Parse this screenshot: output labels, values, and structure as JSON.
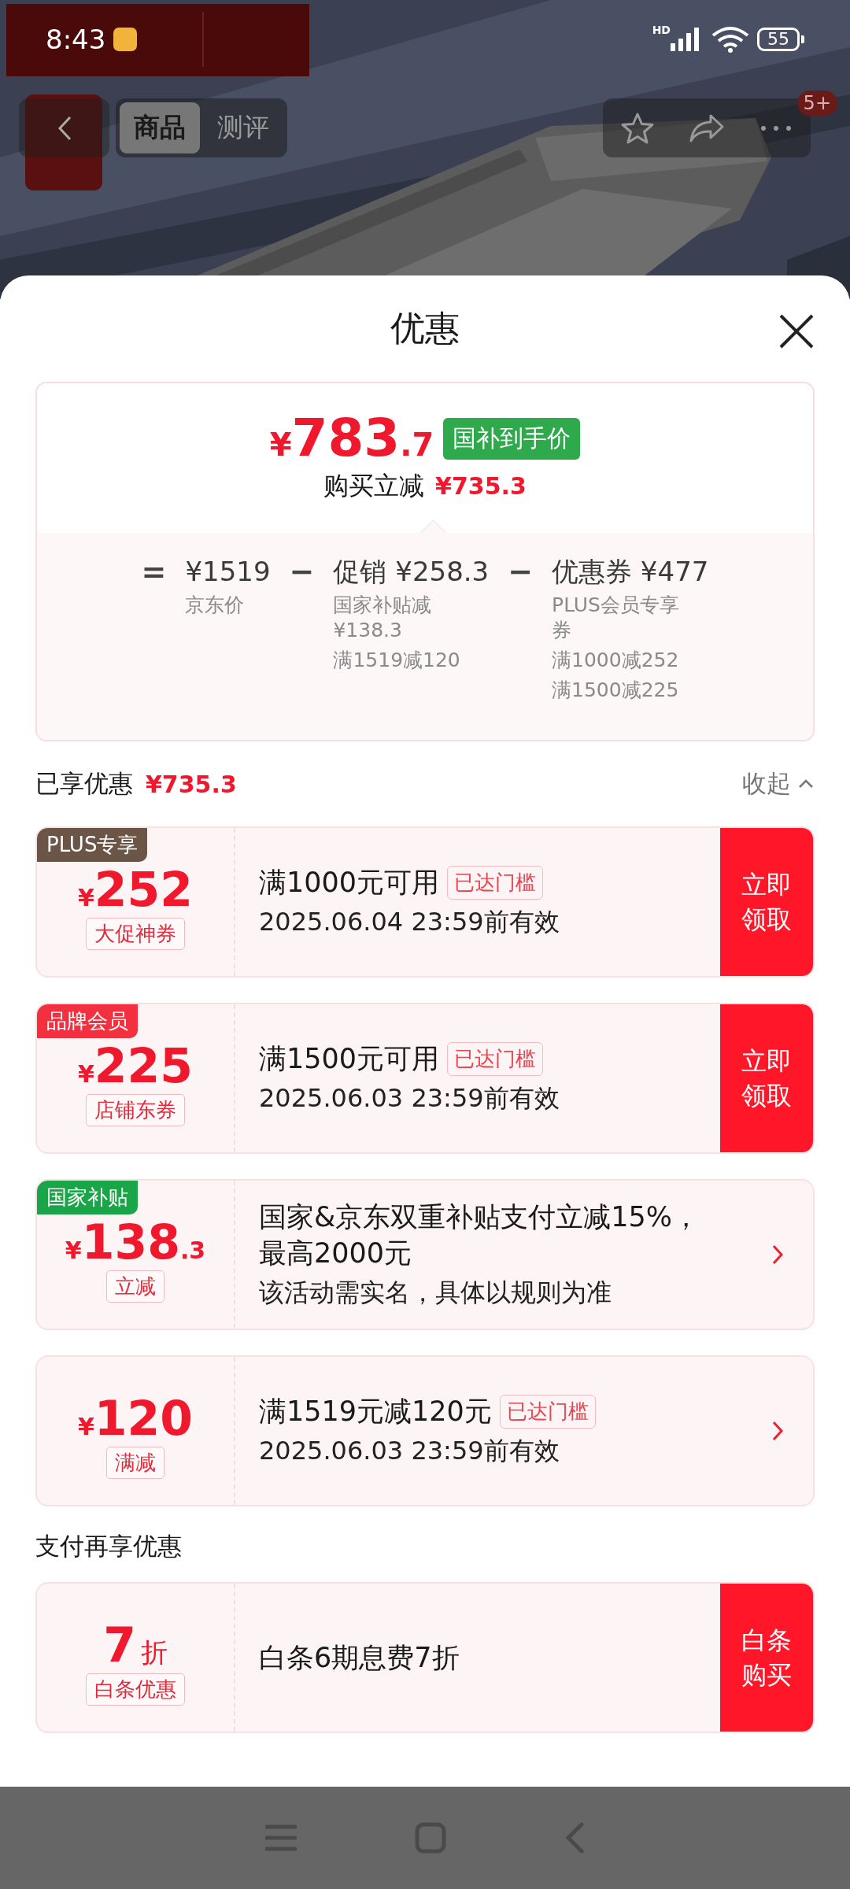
{
  "status_bar": {
    "time": "8:43",
    "network": "HD",
    "battery": "55"
  },
  "nav": {
    "tabs": [
      {
        "label": "商品",
        "selected": true
      },
      {
        "label": "测评",
        "selected": false
      }
    ],
    "badge": "5+"
  },
  "sheet": {
    "title": "优惠"
  },
  "summary": {
    "price": {
      "symbol": "¥",
      "integer": "783",
      "decimal": ".7"
    },
    "price_tag": "国补到手价",
    "saving_label": "购买立减",
    "saving_amount": "¥735.3",
    "breakdown": [
      {
        "kind": "operator",
        "text": "="
      },
      {
        "kind": "term",
        "heading": "¥1519",
        "details": [
          "京东价"
        ]
      },
      {
        "kind": "operator",
        "text": "−"
      },
      {
        "kind": "term",
        "heading": "促销 ¥258.3",
        "details": [
          "国家补贴减¥138.3",
          "满1519减120"
        ]
      },
      {
        "kind": "operator",
        "text": "−"
      },
      {
        "kind": "term",
        "heading": "优惠券 ¥477",
        "details": [
          "PLUS会员专享券",
          "满1000减252",
          "满1500减225"
        ]
      }
    ]
  },
  "enjoyed": {
    "label": "已享优惠",
    "amount": "¥735.3",
    "toggle": "收起"
  },
  "coupons": [
    {
      "tag": {
        "text": "PLUS专享",
        "color": "#6b5546"
      },
      "amount": {
        "symbol": "¥",
        "integer": "252"
      },
      "label": "大促神券",
      "title": "满1000元可用",
      "badge": "已达门槛",
      "subtitle": "2025.06.04 23:59前有效",
      "action": {
        "kind": "button",
        "text": "立即领取"
      }
    },
    {
      "tag": {
        "text": "品牌会员",
        "color": "#f2303f"
      },
      "amount": {
        "symbol": "¥",
        "integer": "225"
      },
      "label": "店铺东券",
      "title": "满1500元可用",
      "badge": "已达门槛",
      "subtitle": "2025.06.03 23:59前有效",
      "action": {
        "kind": "button",
        "text": "立即领取"
      }
    },
    {
      "tag": {
        "text": "国家补贴",
        "color": "#1aa548"
      },
      "amount": {
        "symbol": "¥",
        "integer": "138",
        "decimal": ".3"
      },
      "label": "立减",
      "title": "国家&京东双重补贴支付立减15%，最高2000元",
      "subtitle": "该活动需实名，具体以规则为准",
      "action": {
        "kind": "arrow"
      }
    },
    {
      "amount": {
        "symbol": "¥",
        "integer": "120"
      },
      "label": "满减",
      "title": "满1519元减120元",
      "badge": "已达门槛",
      "subtitle": "2025.06.03 23:59前有效",
      "action": {
        "kind": "arrow"
      }
    }
  ],
  "payment": {
    "title": "支付再享优惠",
    "coupons": [
      {
        "amount": {
          "integer": "7",
          "unit": "折"
        },
        "label": "白条优惠",
        "title": "白条6期息费7折",
        "action": {
          "kind": "button",
          "text": "白条购买"
        }
      }
    ]
  }
}
